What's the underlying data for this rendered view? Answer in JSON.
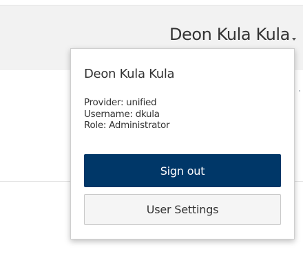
{
  "header": {
    "user_display_name": "Deon Kula Kula"
  },
  "user_menu": {
    "name": "Deon Kula Kula",
    "provider_line": "Provider: unified",
    "username_line": "Username: dkula",
    "role_line": "Role: Administrator",
    "sign_out_label": "Sign out",
    "user_settings_label": "User Settings"
  },
  "icons": {
    "caret": "chevron-down-icon"
  },
  "colors": {
    "primary_button": "#003768",
    "secondary_button": "#f5f5f5",
    "header_background": "#f2f2f2"
  }
}
